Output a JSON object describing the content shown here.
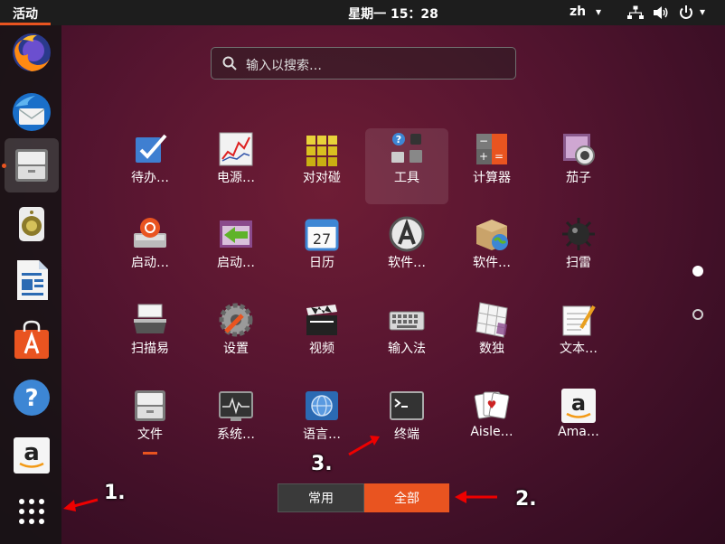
{
  "topbar": {
    "activities": "活动",
    "clock": "星期一 15：28",
    "lang": "zh",
    "lang_arrow": "▾",
    "power_arrow": "▾",
    "icons": [
      "network-icon",
      "volume-icon",
      "power-icon"
    ]
  },
  "dock": {
    "items": [
      {
        "name": "firefox",
        "icon": "firefox-icon"
      },
      {
        "name": "thunderbird",
        "icon": "thunderbird-icon"
      },
      {
        "name": "files",
        "icon": "files-icon",
        "active": true
      },
      {
        "name": "rhythmbox",
        "icon": "speaker-icon"
      },
      {
        "name": "libreoffice-writer",
        "icon": "writer-icon"
      },
      {
        "name": "ubuntu-software",
        "icon": "software-bag-icon"
      },
      {
        "name": "help",
        "icon": "help-icon"
      },
      {
        "name": "amazon",
        "icon": "amazon-icon"
      },
      {
        "name": "show-applications",
        "icon": "grid-icon"
      }
    ]
  },
  "search": {
    "placeholder": "输入以搜索…"
  },
  "apps": [
    {
      "label": "待办…"
    },
    {
      "label": "电源…"
    },
    {
      "label": "对对碰"
    },
    {
      "label": "工具"
    },
    {
      "label": "计算器"
    },
    {
      "label": "茄子"
    },
    {
      "label": "启动…"
    },
    {
      "label": "启动…"
    },
    {
      "label": "日历"
    },
    {
      "label": "软件…"
    },
    {
      "label": "软件…"
    },
    {
      "label": "扫雷"
    },
    {
      "label": "扫描易"
    },
    {
      "label": "设置"
    },
    {
      "label": "视频"
    },
    {
      "label": "输入法"
    },
    {
      "label": "数独"
    },
    {
      "label": "文本…"
    },
    {
      "label": "文件"
    },
    {
      "label": "系统…"
    },
    {
      "label": "语言…"
    },
    {
      "label": "终端"
    },
    {
      "label": "Aisle…"
    },
    {
      "label": "Ama…"
    }
  ],
  "calendar_day": "27",
  "tabs": {
    "frequent": "常用",
    "all": "全部",
    "selected": "all"
  },
  "annotations": {
    "one": "1.",
    "two": "2.",
    "three": "3."
  },
  "colors": {
    "accent": "#e95420",
    "panel": "#1d1d1d",
    "tab_inactive": "#3a3a3a"
  }
}
